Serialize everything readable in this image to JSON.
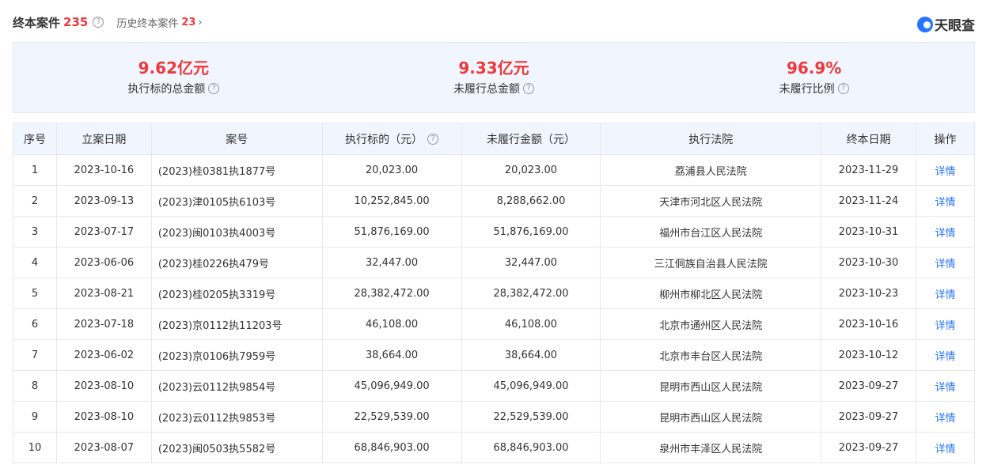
{
  "header": {
    "title": "终本案件",
    "count": "235",
    "history_label": "历史终本案件",
    "history_count": "23",
    "logo_text": "天眼查"
  },
  "stats": [
    {
      "value": "9.62亿元",
      "label": "执行标的总金额"
    },
    {
      "value": "9.33亿元",
      "label": "未履行总金额"
    },
    {
      "value": "96.9%",
      "label": "未履行比例"
    }
  ],
  "table": {
    "headers": [
      "序号",
      "立案日期",
      "案号",
      "执行标的（元）",
      "未履行金额（元）",
      "执行法院",
      "终本日期",
      "操作"
    ],
    "rows": [
      {
        "no": "1",
        "filed": "2023-10-16",
        "case": "(2023)桂0381执1877号",
        "target": "20,023.00",
        "unpaid": "20,023.00",
        "court": "荔浦县人民法院",
        "ended": "2023-11-29",
        "action": "详情"
      },
      {
        "no": "2",
        "filed": "2023-09-13",
        "case": "(2023)津0105执6103号",
        "target": "10,252,845.00",
        "unpaid": "8,288,662.00",
        "court": "天津市河北区人民法院",
        "ended": "2023-11-24",
        "action": "详情"
      },
      {
        "no": "3",
        "filed": "2023-07-17",
        "case": "(2023)闽0103执4003号",
        "target": "51,876,169.00",
        "unpaid": "51,876,169.00",
        "court": "福州市台江区人民法院",
        "ended": "2023-10-31",
        "action": "详情"
      },
      {
        "no": "4",
        "filed": "2023-06-06",
        "case": "(2023)桂0226执479号",
        "target": "32,447.00",
        "unpaid": "32,447.00",
        "court": "三江侗族自治县人民法院",
        "ended": "2023-10-30",
        "action": "详情"
      },
      {
        "no": "5",
        "filed": "2023-08-21",
        "case": "(2023)桂0205执3319号",
        "target": "28,382,472.00",
        "unpaid": "28,382,472.00",
        "court": "柳州市柳北区人民法院",
        "ended": "2023-10-23",
        "action": "详情"
      },
      {
        "no": "6",
        "filed": "2023-07-18",
        "case": "(2023)京0112执11203号",
        "target": "46,108.00",
        "unpaid": "46,108.00",
        "court": "北京市通州区人民法院",
        "ended": "2023-10-16",
        "action": "详情"
      },
      {
        "no": "7",
        "filed": "2023-06-02",
        "case": "(2023)京0106执7959号",
        "target": "38,664.00",
        "unpaid": "38,664.00",
        "court": "北京市丰台区人民法院",
        "ended": "2023-10-12",
        "action": "详情"
      },
      {
        "no": "8",
        "filed": "2023-08-10",
        "case": "(2023)云0112执9854号",
        "target": "45,096,949.00",
        "unpaid": "45,096,949.00",
        "court": "昆明市西山区人民法院",
        "ended": "2023-09-27",
        "action": "详情"
      },
      {
        "no": "9",
        "filed": "2023-08-10",
        "case": "(2023)云0112执9853号",
        "target": "22,529,539.00",
        "unpaid": "22,529,539.00",
        "court": "昆明市西山区人民法院",
        "ended": "2023-09-27",
        "action": "详情"
      },
      {
        "no": "10",
        "filed": "2023-08-07",
        "case": "(2023)闽0503执5582号",
        "target": "68,846,903.00",
        "unpaid": "68,846,903.00",
        "court": "泉州市丰泽区人民法院",
        "ended": "2023-09-27",
        "action": "详情"
      }
    ]
  },
  "colors": {
    "accent_red": "#f0373a",
    "link_blue": "#2475ff",
    "panel_bg": "#f1f6fe"
  }
}
